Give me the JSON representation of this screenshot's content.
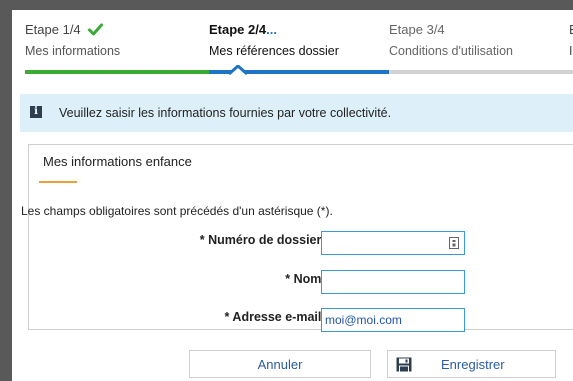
{
  "stepper": {
    "steps": [
      {
        "title": "Etape 1/4",
        "subtitle": "Mes informations",
        "status": "complete"
      },
      {
        "title": "Etape 2/4",
        "title_suffix": "...",
        "subtitle": "Mes références dossier",
        "status": "current"
      },
      {
        "title": "Etape 3/4",
        "subtitle": "Conditions d'utilisation",
        "status": "pending"
      },
      {
        "title": "E",
        "subtitle": "I",
        "status": "pending"
      }
    ],
    "colors": {
      "complete": "#3aaa35",
      "current": "#1f73c4",
      "pending": "#d3d3d3"
    }
  },
  "info_banner": {
    "icon": "info-icon",
    "text": "Veuillez saisir les informations fournies par votre collectivité."
  },
  "form": {
    "section_title": "Mes informations enfance",
    "required_note": "Les champs obligatoires sont précédés d'un astérisque (*).",
    "fields": {
      "dossier": {
        "label": "* Numéro de dossier :",
        "value": ""
      },
      "nom": {
        "label": "* Nom :",
        "value": ""
      },
      "email": {
        "label": "* Adresse e-mail :",
        "value": "moi@moi.com"
      }
    }
  },
  "actions": {
    "cancel_label": "Annuler",
    "save_label": "Enregistrer",
    "save_icon": "floppy-disk-icon"
  },
  "accent": {
    "underline": "#e8a23c",
    "banner_bg": "#ddf0f9",
    "input_border": "#3a9ad9"
  }
}
